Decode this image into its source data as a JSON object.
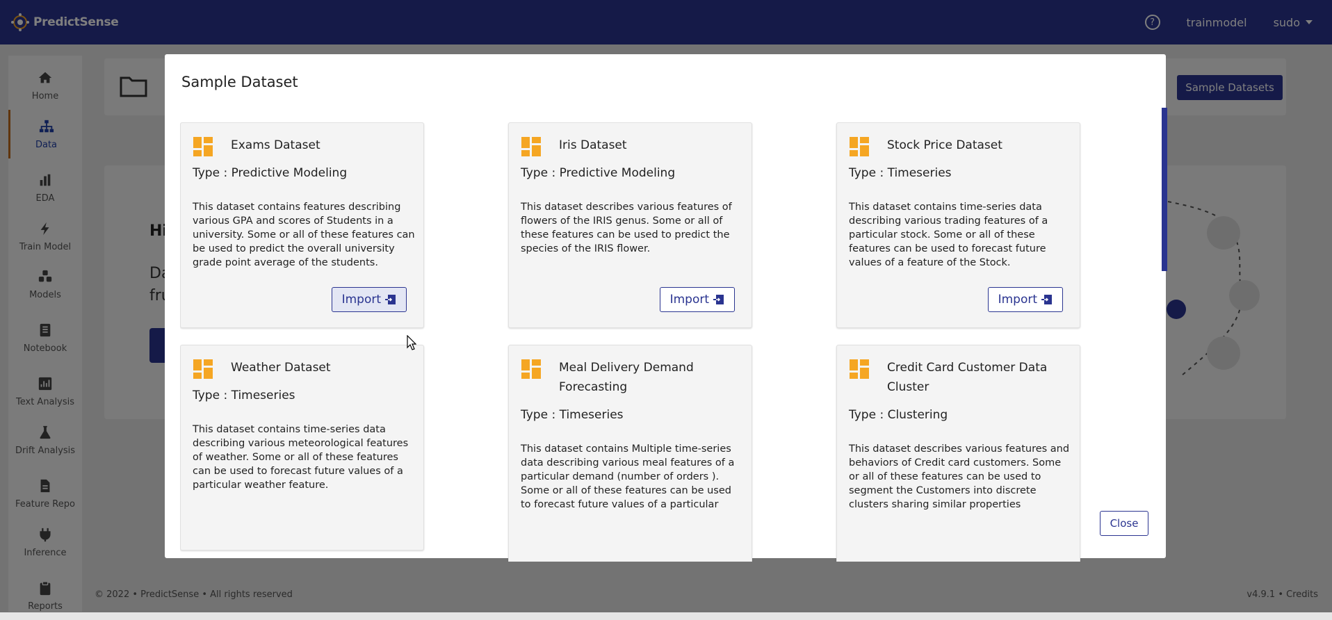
{
  "app": {
    "name": "PredictSense"
  },
  "header": {
    "help_icon": "question-circle-icon",
    "project": "trainmodel",
    "user": "sudo"
  },
  "sidebar": {
    "items": [
      {
        "label": "Home",
        "icon": "home-icon"
      },
      {
        "label": "Data",
        "icon": "sitemap-icon",
        "active": true
      },
      {
        "label": "EDA",
        "icon": "bar-chart-icon"
      },
      {
        "label": "Train Model",
        "icon": "bolt-icon"
      },
      {
        "label": "Models",
        "icon": "cubes-icon"
      },
      {
        "label": "Notebook",
        "icon": "notebook-icon"
      },
      {
        "label": "Text Analysis",
        "icon": "text-chart-icon"
      },
      {
        "label": "Drift Analysis",
        "icon": "flask-icon"
      },
      {
        "label": "Feature Repo",
        "icon": "file-icon"
      },
      {
        "label": "Inference",
        "icon": "plug-icon"
      },
      {
        "label": "Reports",
        "icon": "clipboard-icon"
      }
    ]
  },
  "background": {
    "sample_datasets_label": "Sample Datasets",
    "greeting": "Hi",
    "text_line1": "Da",
    "text_line2": "fru"
  },
  "modal": {
    "title": "Sample Dataset",
    "close_label": "Close",
    "import_label": "Import",
    "datasets": [
      {
        "name": "Exams Dataset",
        "type": "Type : Predictive Modeling",
        "description": "This dataset contains features describing various GPA and scores of Students in a university. Some or all of these features can be used to predict the overall university grade point average of the students."
      },
      {
        "name": "Iris Dataset",
        "type": "Type : Predictive Modeling",
        "description": "This dataset describes various features of flowers of the IRIS genus. Some or all of these features can be used to predict the species of the IRIS flower."
      },
      {
        "name": "Stock Price Dataset",
        "type": "Type : Timeseries",
        "description": "This dataset contains time-series data describing various trading features of a particular stock. Some or all of these features can be used to forecast future values of a feature of the Stock."
      },
      {
        "name": "Weather Dataset",
        "type": "Type : Timeseries",
        "description": "This dataset contains time-series data describing various meteorological features of weather. Some or all of these features can be used to forecast future values of a particular weather feature."
      },
      {
        "name": "Meal Delivery Demand Forecasting",
        "type": "Type : Timeseries",
        "description": "This dataset contains Multiple time-series data describing various meal features of a particular demand (number of orders ). Some or all of these features can be used to forecast future values of a particular"
      },
      {
        "name": "Credit Card Customer Data Cluster",
        "type": "Type : Clustering",
        "description": "This dataset describes various features and behaviors of Credit card customers. Some or all of these features can be used to segment the Customers into discrete clusters sharing similar properties"
      }
    ]
  },
  "footer": {
    "copyright": "© 2022 • PredictSense • All rights reserved",
    "version": "v4.9.1 • Credits"
  },
  "colors": {
    "primary": "#2a3490",
    "accent": "#f5a623"
  }
}
